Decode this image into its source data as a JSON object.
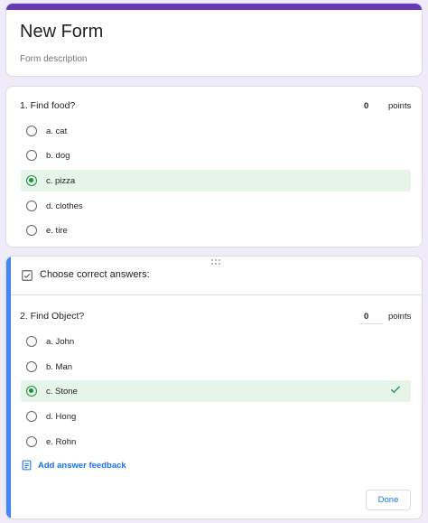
{
  "form": {
    "title": "New Form",
    "description": "Form description"
  },
  "q1": {
    "title": "1. Find food?",
    "points_value": "0",
    "points_label": "points",
    "options": [
      "a. cat",
      "b. dog",
      "c. pizza",
      "d. clothes",
      "e. tire"
    ],
    "selected_index": 2
  },
  "q2": {
    "answer_key_label": "Choose correct answers:",
    "title": "2. Find Object?",
    "points_value": "0",
    "points_label": "points",
    "options": [
      "a. John",
      "b. Man",
      "c. Stone",
      "d. Hong",
      "e. Rohn"
    ],
    "selected_index": 2,
    "feedback_label": "Add answer feedback",
    "done_label": "Done"
  },
  "colors": {
    "theme": "#673ab7",
    "background": "#f0ebf8",
    "accent_blue": "#4285f4",
    "selected_bg": "#e6f4ea",
    "selected_green": "#1e8e3e",
    "link_blue": "#1a73e8"
  },
  "icons": {
    "drag": "drag-handle-icon",
    "answer_key": "checkbox-checked-icon",
    "correct": "check-icon",
    "feedback": "feedback-icon"
  }
}
